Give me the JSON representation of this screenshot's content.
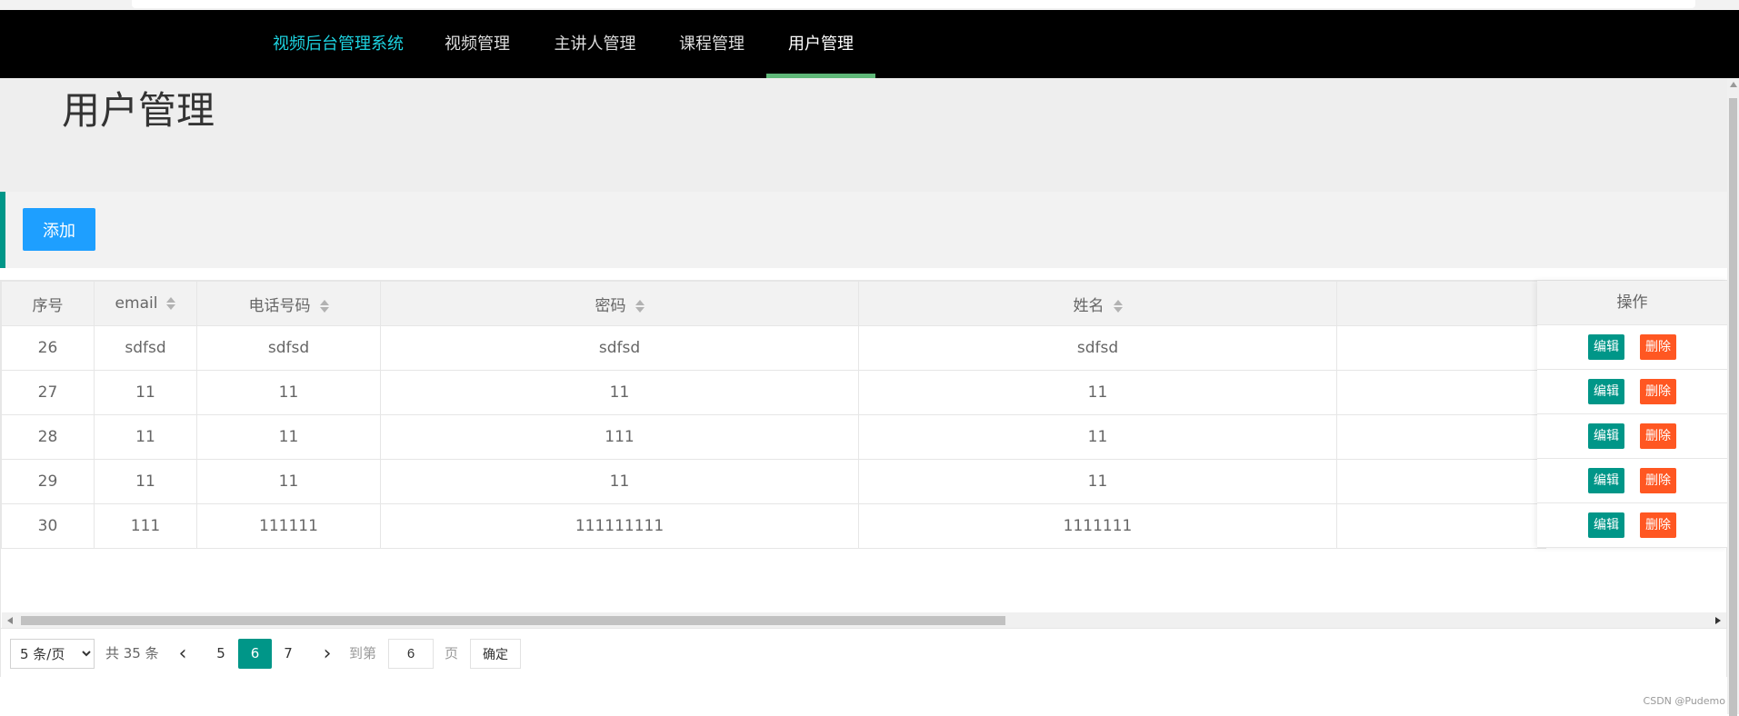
{
  "nav": {
    "brand": "视频后台管理系统",
    "items": [
      {
        "label": "视频管理"
      },
      {
        "label": "主讲人管理"
      },
      {
        "label": "课程管理"
      },
      {
        "label": "用户管理"
      }
    ],
    "active_index": 3
  },
  "page": {
    "title": "用户管理"
  },
  "toolbar": {
    "add_label": "添加"
  },
  "table": {
    "headers": [
      "序号",
      "email",
      "电话号码",
      "密码",
      "姓名",
      "",
      "操作"
    ],
    "rows": [
      {
        "id": "26",
        "email": "sdfsd",
        "phone": "sdfsd",
        "password": "sdfsd",
        "name": "sdfsd"
      },
      {
        "id": "27",
        "email": "11",
        "phone": "11",
        "password": "11",
        "name": "11"
      },
      {
        "id": "28",
        "email": "11",
        "phone": "11",
        "password": "111",
        "name": "11"
      },
      {
        "id": "29",
        "email": "11",
        "phone": "11",
        "password": "11",
        "name": "11"
      },
      {
        "id": "30",
        "email": "111",
        "phone": "111111",
        "password": "111111111",
        "name": "1111111"
      }
    ],
    "edit_label": "编辑",
    "delete_label": "删除"
  },
  "pager": {
    "page_size": "5 条/页",
    "page_size_options": [
      "5 条/页"
    ],
    "total": "共 35 条",
    "prev": "‹",
    "next": "›",
    "pages": [
      "5",
      "6",
      "7"
    ],
    "current": "6",
    "goto_label": "到第",
    "goto_value": "6",
    "page_unit": "页",
    "confirm": "确定"
  },
  "watermark": "CSDN @Pudemo",
  "colors": {
    "brand_text": "#1dd3e0",
    "nav_bg": "#000000",
    "nav_active_bar": "#5fb878",
    "add_button": "#1e9fff",
    "edit_button": "#009688",
    "delete_button": "#ff5722",
    "current_page": "#009688"
  }
}
